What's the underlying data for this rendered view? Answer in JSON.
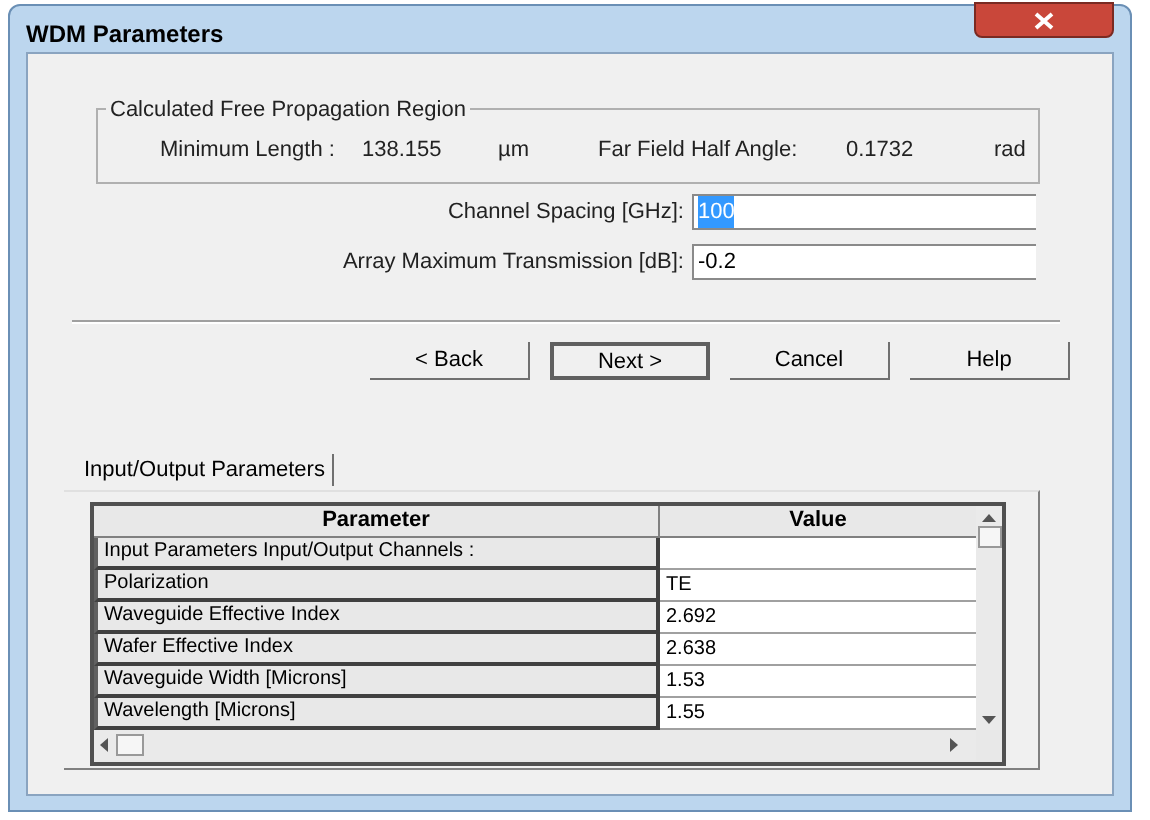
{
  "window": {
    "title": "WDM Parameters"
  },
  "region_group": {
    "title": "Calculated Free Propagation Region",
    "items": [
      {
        "label": "Minimum Length :",
        "value": "138.155",
        "unit": "µm"
      },
      {
        "label": "Far Field Half Angle:",
        "value": "0.1732",
        "unit": "rad"
      }
    ]
  },
  "fields": [
    {
      "label": "Channel Spacing [GHz]:",
      "value": "100",
      "highlighted": true
    },
    {
      "label": "Array Maximum Transmission [dB]:",
      "value": "-0.2",
      "highlighted": false
    }
  ],
  "buttons": [
    {
      "label": "< Back",
      "default": false
    },
    {
      "label": "Next >",
      "default": true
    },
    {
      "label": "Cancel",
      "default": false
    },
    {
      "label": "Help",
      "default": false
    }
  ],
  "tabs": [
    {
      "label": "Input/Output Parameters",
      "selected": true
    }
  ],
  "table": {
    "columns": [
      "Parameter",
      "Value"
    ],
    "rows": [
      [
        "Input Parameters Input/Output Channels :",
        ""
      ],
      [
        "Polarization",
        "TE"
      ],
      [
        "Waveguide Effective Index",
        "2.692"
      ],
      [
        "Wafer Effective Index",
        "2.638"
      ],
      [
        "Waveguide Width [Microns]",
        "1.53"
      ],
      [
        "Wavelength [Microns]",
        "1.55"
      ]
    ]
  }
}
